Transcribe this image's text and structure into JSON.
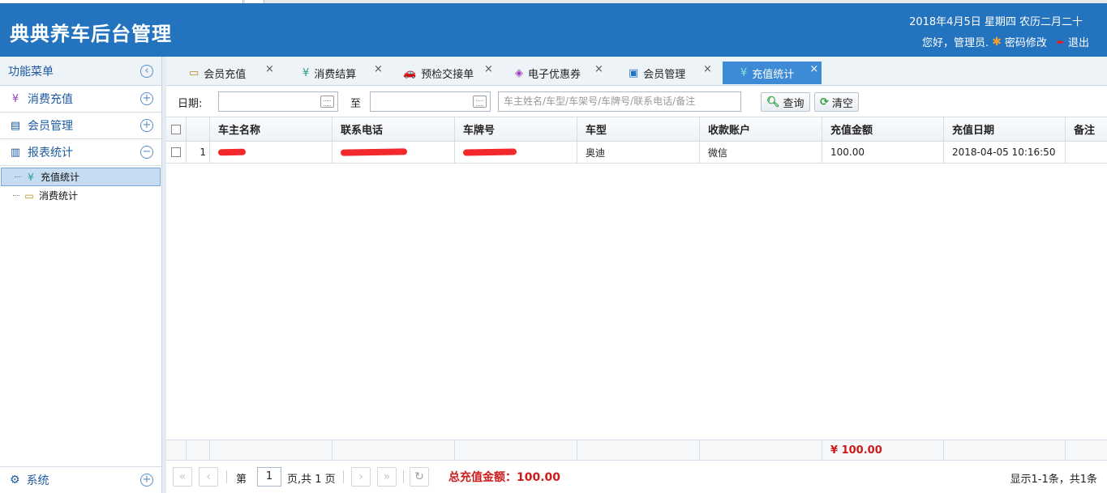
{
  "header": {
    "title": "典典养车后台管理",
    "date": "2018年4月5日 星期四 农历二月二十",
    "greeting": "您好，管理员.",
    "change_password": "密码修改",
    "logout": "退出"
  },
  "sidebar": {
    "title": "功能菜单",
    "sections": [
      {
        "label": "消费充值"
      },
      {
        "label": "会员管理"
      },
      {
        "label": "报表统计"
      }
    ],
    "tree": [
      {
        "label": "充值统计"
      },
      {
        "label": "消费统计"
      }
    ],
    "bottom": {
      "label": "系统"
    }
  },
  "tabs": [
    {
      "label": "会员充值"
    },
    {
      "label": "消费结算"
    },
    {
      "label": "预检交接单"
    },
    {
      "label": "电子优惠券"
    },
    {
      "label": "会员管理"
    },
    {
      "label": "充值统计"
    }
  ],
  "toolbar": {
    "date_label": "日期:",
    "to_label": "至",
    "search_placeholder": "车主姓名/车型/车架号/车牌号/联系电话/备注",
    "query_label": "查询",
    "clear_label": "清空"
  },
  "table": {
    "columns": [
      "车主名称",
      "联系电话",
      "车牌号",
      "车型",
      "收款账户",
      "充值金额",
      "充值日期",
      "备注"
    ],
    "rows": [
      {
        "index": "1",
        "car_model": "奥迪",
        "account": "微信",
        "amount": "100.00",
        "date": "2018-04-05 10:16:50",
        "note": ""
      }
    ],
    "footer_total": "¥ 100.00"
  },
  "pager": {
    "page_prefix": "第",
    "page_value": "1",
    "page_suffix": "页,共 1 页",
    "total_label": "总充值金额：100.00",
    "info": "显示1-1条，共1条"
  },
  "colors": {
    "header_bg": "#2373be",
    "active_tab": "#3d8ad6",
    "total_red": "#cc1b1b"
  }
}
